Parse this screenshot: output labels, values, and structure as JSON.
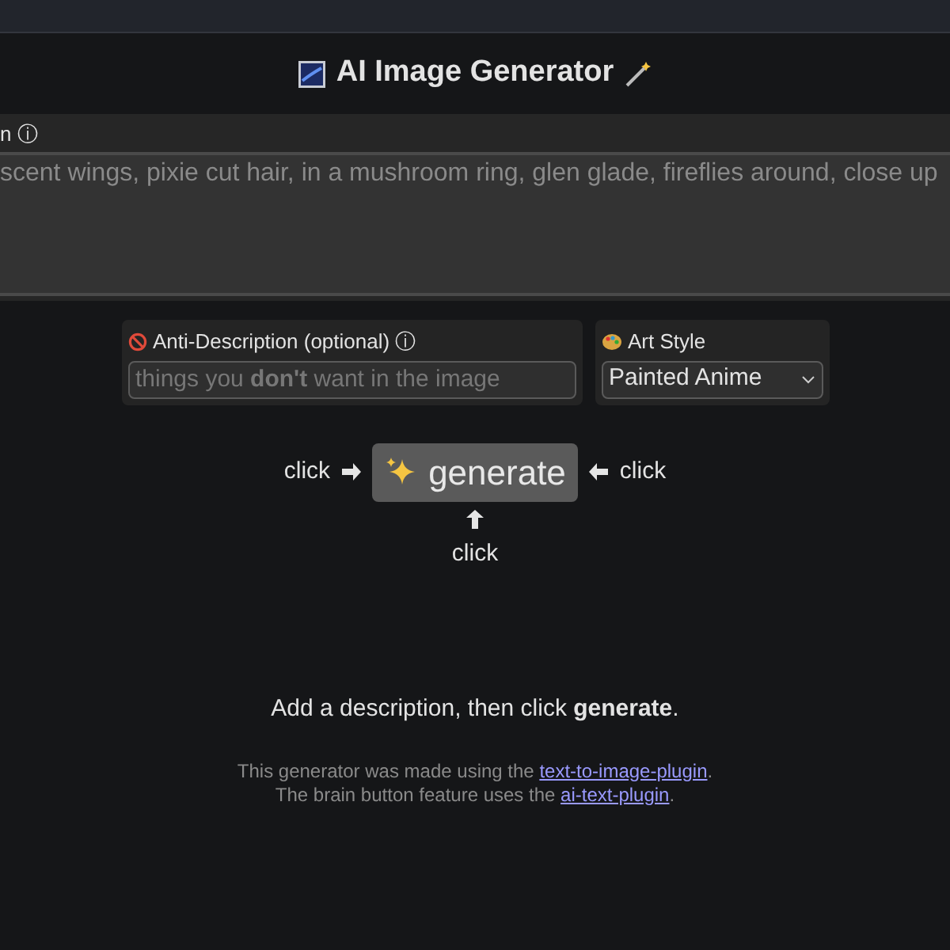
{
  "header": {
    "title": "AI Image Generator"
  },
  "description": {
    "label": "n ⓘ",
    "placeholder": "scent wings, pixie cut hair, in a mushroom ring, glen glade, fireflies around, close up"
  },
  "anti_description": {
    "label": "Anti-Description (optional) ⓘ",
    "placeholder": "things you **don't** want in the image"
  },
  "art_style": {
    "label": "Art Style",
    "value": "Painted Anime"
  },
  "generate": {
    "label": "generate",
    "hints": [
      "click",
      "click",
      "click"
    ]
  },
  "status": "Add a description, then click **generate**.",
  "footer": [
    {
      "before": "This generator was made using the ",
      "link": "text-to-image-plugin",
      "after": "."
    },
    {
      "before": "The brain button feature uses the ",
      "link": "ai-text-plugin",
      "after": "."
    }
  ]
}
